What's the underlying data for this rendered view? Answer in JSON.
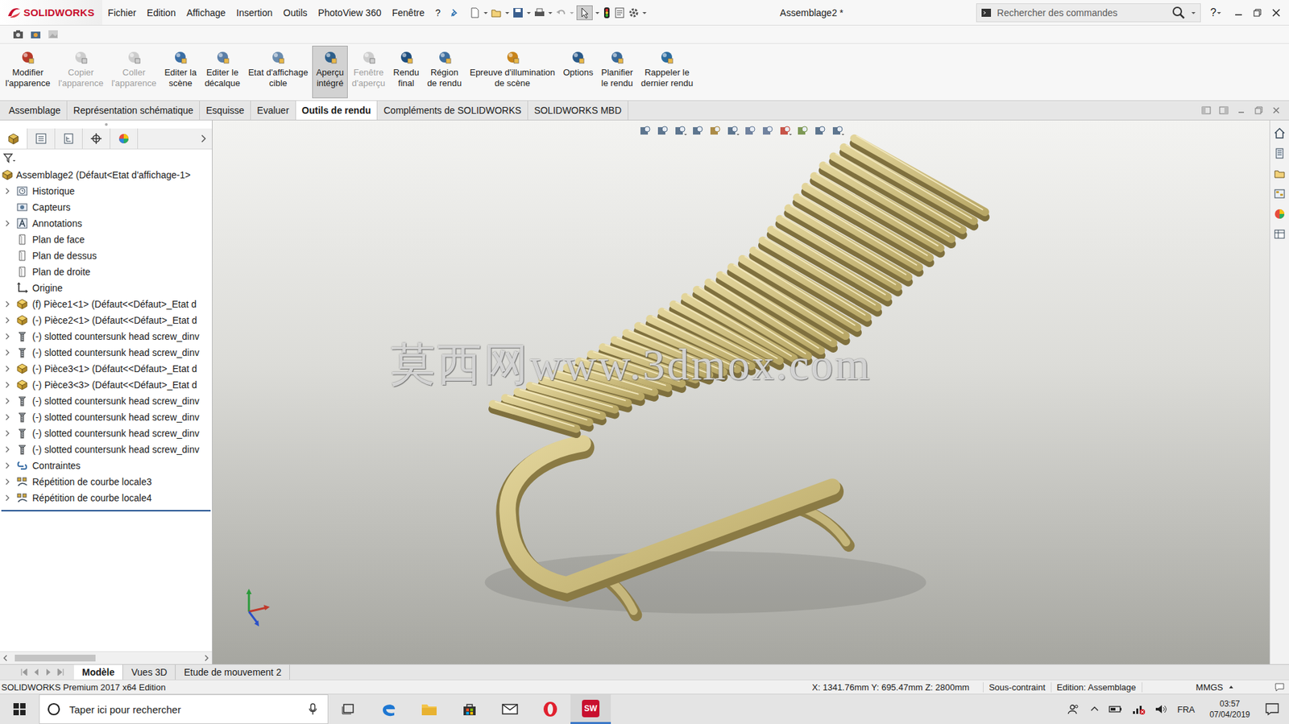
{
  "app": {
    "logo": "SOLIDWORKS",
    "title": "Assemblage2 *",
    "help": "?"
  },
  "menu": [
    "Fichier",
    "Edition",
    "Affichage",
    "Insertion",
    "Outils",
    "PhotoView 360",
    "Fenêtre",
    "?"
  ],
  "search": {
    "placeholder": "Rechercher des commandes"
  },
  "ribbon": [
    {
      "lines": [
        "Modifier",
        "l'apparence"
      ],
      "disabled": false,
      "selected": false
    },
    {
      "lines": [
        "Copier",
        "l'apparence"
      ],
      "disabled": true,
      "selected": false
    },
    {
      "lines": [
        "Coller",
        "l'apparence"
      ],
      "disabled": true,
      "selected": false
    },
    {
      "lines": [
        "Editer la",
        "scène"
      ],
      "disabled": false,
      "selected": false
    },
    {
      "lines": [
        "Editer le",
        "décalque"
      ],
      "disabled": false,
      "selected": false
    },
    {
      "lines": [
        "Etat d'affichage",
        "cible"
      ],
      "disabled": false,
      "selected": false
    },
    {
      "lines": [
        "Aperçu",
        "intégré"
      ],
      "disabled": false,
      "selected": true
    },
    {
      "lines": [
        "Fenêtre",
        "d'aperçu"
      ],
      "disabled": true,
      "selected": false
    },
    {
      "lines": [
        "Rendu",
        "final"
      ],
      "disabled": false,
      "selected": false
    },
    {
      "lines": [
        "Région",
        "de rendu"
      ],
      "disabled": false,
      "selected": false
    },
    {
      "lines": [
        "Epreuve d'illumination",
        "de scène"
      ],
      "disabled": false,
      "selected": false
    },
    {
      "lines": [
        "Options"
      ],
      "disabled": false,
      "selected": false
    },
    {
      "lines": [
        "Planifier",
        "le rendu"
      ],
      "disabled": false,
      "selected": false
    },
    {
      "lines": [
        "Rappeler le",
        "dernier rendu"
      ],
      "disabled": false,
      "selected": false
    }
  ],
  "tabs": [
    {
      "label": "Assemblage",
      "selected": false
    },
    {
      "label": "Représentation schématique",
      "selected": false
    },
    {
      "label": "Esquisse",
      "selected": false
    },
    {
      "label": "Evaluer",
      "selected": false
    },
    {
      "label": "Outils de rendu",
      "selected": true
    },
    {
      "label": "Compléments de SOLIDWORKS",
      "selected": false
    },
    {
      "label": "SOLIDWORKS MBD",
      "selected": false
    }
  ],
  "tree": {
    "root": "Assemblage2 (Défaut<Etat d'affichage-1>",
    "items": [
      {
        "label": "Historique",
        "kind": "history",
        "expandable": true
      },
      {
        "label": "Capteurs",
        "kind": "sensor",
        "expandable": false
      },
      {
        "label": "Annotations",
        "kind": "annotation",
        "expandable": true
      },
      {
        "label": "Plan de face",
        "kind": "plane",
        "expandable": false
      },
      {
        "label": "Plan de dessus",
        "kind": "plane",
        "expandable": false
      },
      {
        "label": "Plan de droite",
        "kind": "plane",
        "expandable": false
      },
      {
        "label": "Origine",
        "kind": "origin",
        "expandable": false
      },
      {
        "label": "(f) Pièce1<1> (Défaut<<Défaut>_Etat d",
        "kind": "part",
        "expandable": true
      },
      {
        "label": "(-) Pièce2<1> (Défaut<<Défaut>_Etat d",
        "kind": "part",
        "expandable": true
      },
      {
        "label": "(-) slotted countersunk head screw_dinv",
        "kind": "screw",
        "expandable": true
      },
      {
        "label": "(-) slotted countersunk head screw_dinv",
        "kind": "screw",
        "expandable": true
      },
      {
        "label": "(-) Pièce3<1> (Défaut<<Défaut>_Etat d",
        "kind": "part",
        "expandable": true
      },
      {
        "label": "(-) Pièce3<3> (Défaut<<Défaut>_Etat d",
        "kind": "part",
        "expandable": true
      },
      {
        "label": "(-) slotted countersunk head screw_dinv",
        "kind": "screw",
        "expandable": true
      },
      {
        "label": "(-) slotted countersunk head screw_dinv",
        "kind": "screw",
        "expandable": true
      },
      {
        "label": "(-) slotted countersunk head screw_dinv",
        "kind": "screw",
        "expandable": true
      },
      {
        "label": "(-) slotted countersunk head screw_dinv",
        "kind": "screw",
        "expandable": true
      },
      {
        "label": "Contraintes",
        "kind": "mates",
        "expandable": true
      },
      {
        "label": "Répétition de courbe locale3",
        "kind": "pattern",
        "expandable": true
      },
      {
        "label": "Répétition de courbe locale4",
        "kind": "pattern",
        "expandable": true
      }
    ]
  },
  "viewport": {
    "watermark": "莫西网www.3dmox.com"
  },
  "bottom_tabs": [
    {
      "label": "Modèle",
      "selected": true
    },
    {
      "label": "Vues 3D",
      "selected": false
    },
    {
      "label": "Etude de mouvement 2",
      "selected": false
    }
  ],
  "status_bar": {
    "edition": "SOLIDWORKS Premium 2017 x64 Edition",
    "coords": "X: 1341.76mm Y: 695.47mm Z: 2800mm",
    "constraint": "Sous-contraint",
    "mode": "Edition: Assemblage",
    "units": "MMGS"
  },
  "taskbar": {
    "search_placeholder": "Taper ici pour rechercher",
    "app_badge": "SW",
    "language": "FRA",
    "time": "03:57",
    "date": "07/04/2019"
  }
}
